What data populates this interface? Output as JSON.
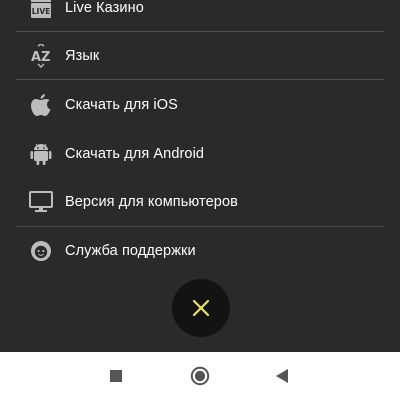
{
  "menu": {
    "items": [
      {
        "label": "Live Казино",
        "icon": "live-casino-icon",
        "badge": "LIVE"
      },
      {
        "label": "Язык",
        "icon": "language-az-icon"
      },
      {
        "label": "Скачать для iOS",
        "icon": "apple-icon"
      },
      {
        "label": "Скачать для Android",
        "icon": "android-icon"
      },
      {
        "label": "Версия для компьютеров",
        "icon": "desktop-monitor-icon"
      },
      {
        "label": "Служба поддержки",
        "icon": "support-agent-icon"
      }
    ]
  },
  "close_button": {
    "icon": "close-icon",
    "color": "#e6e36a"
  },
  "navbar": {
    "buttons": [
      {
        "name": "recent-apps",
        "icon": "square-icon"
      },
      {
        "name": "home",
        "icon": "circle-icon"
      },
      {
        "name": "back",
        "icon": "triangle-back-icon"
      }
    ]
  },
  "colors": {
    "background": "#2a2a2a",
    "text": "#ffffff",
    "icon": "#bdbdbd",
    "accent": "#e6e36a"
  }
}
